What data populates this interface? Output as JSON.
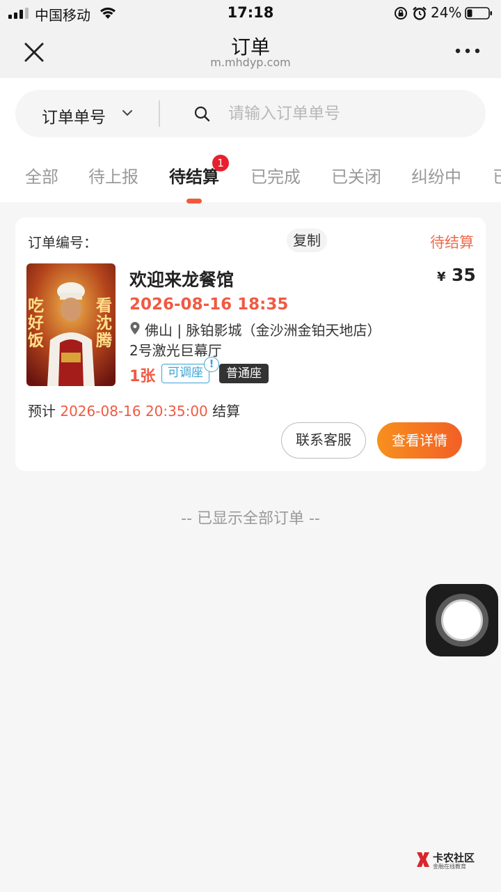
{
  "status_bar": {
    "carrier": "中国移动",
    "time": "17:18",
    "battery": "24%"
  },
  "header": {
    "title": "订单",
    "url": "m.mhdyp.com"
  },
  "search": {
    "type_label": "订单单号",
    "placeholder": "请输入订单单号"
  },
  "tabs": [
    {
      "label": "全部"
    },
    {
      "label": "待上报"
    },
    {
      "label": "待结算",
      "badge": "1",
      "active": true
    },
    {
      "label": "已完成"
    },
    {
      "label": "已关闭"
    },
    {
      "label": "纠纷中"
    },
    {
      "label": "已"
    }
  ],
  "order": {
    "order_no_label": "订单编号：",
    "copy_label": "复制",
    "status": "待结算",
    "poster": {
      "text_left": "吃好饭",
      "text_right": "看沈腾"
    },
    "movie_title": "欢迎来龙餐馆",
    "price_symbol": "¥",
    "price": "35",
    "showtime": "2026-08-16 18:35",
    "cinema": "佛山 | 脉铂影城（金沙洲金铂天地店）",
    "hall": "2号激光巨幕厅",
    "tickets": "1张",
    "adjust_tag": "可调座",
    "seat_tag": "普通座",
    "settle_prefix": "预计",
    "settle_time": "2026-08-16 20:35:00",
    "settle_suffix": "结算",
    "contact_label": "联系客服",
    "detail_label": "查看详情"
  },
  "end_text": "-- 已显示全部订单 --",
  "watermark": {
    "name": "卡农社区",
    "sub": "金融在线教育"
  },
  "colors": {
    "accent": "#ef5a43",
    "button_gradient_start": "#f7901e",
    "button_gradient_end": "#f25f26",
    "badge": "#e8202e",
    "tag_blue": "#3aa3d8"
  }
}
